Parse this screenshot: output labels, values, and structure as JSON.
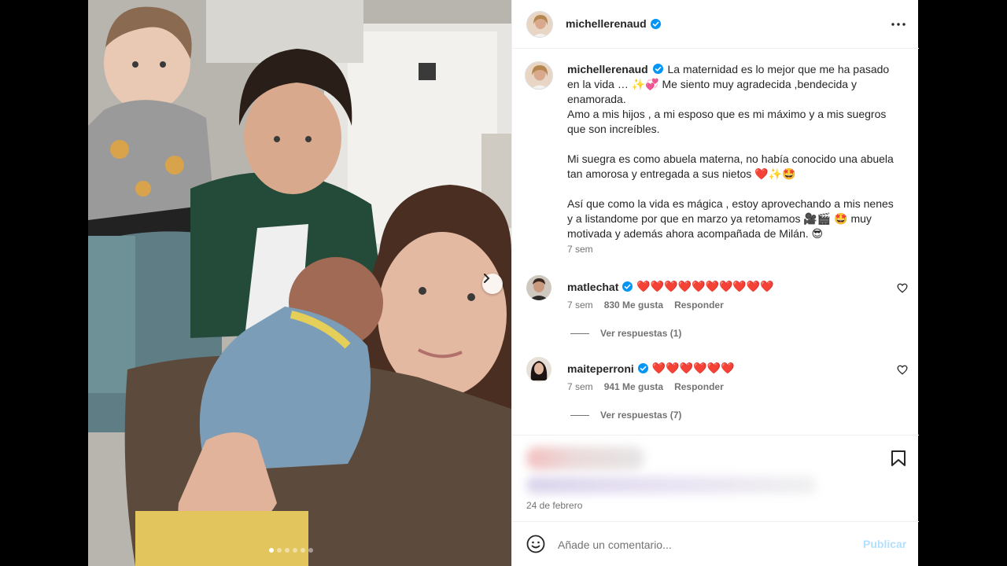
{
  "post": {
    "username": "michellerenaud",
    "verified": true,
    "caption": {
      "username": "michellerenaud",
      "lines": [
        "La maternidad es lo mejor que me ha pasado en la vida … ✨💞 Me siento muy agradecida ,bendecida y enamorada.",
        "Amo a mis hijos , a mi esposo que es mi máximo y a mis suegros que son increíbles.",
        "",
        "Mi suegra es como abuela materna, no había conocido una abuela tan amorosa y entregada a sus nietos ❤️✨🤩",
        "",
        "Así que como la vida es mágica , estoy aprovechando a mis nenes y a listandome por que en marzo ya retomamos 🎥🎬 🤩 muy motivada y además ahora acompañada de Milán. 😎"
      ],
      "time": "7 sem"
    },
    "date": "24 de febrero",
    "carousel": {
      "dot_count": 6,
      "active_index": 0
    }
  },
  "comments": [
    {
      "username": "matlechat",
      "verified": true,
      "text": "❤️❤️❤️❤️❤️❤️❤️❤️❤️❤️",
      "time": "7 sem",
      "likes": "830 Me gusta",
      "reply_label": "Responder",
      "view_replies": "Ver respuestas (1)"
    },
    {
      "username": "maiteperroni",
      "verified": true,
      "text": "❤️❤️❤️❤️❤️❤️",
      "time": "7 sem",
      "likes": "941 Me gusta",
      "reply_label": "Responder",
      "view_replies": "Ver respuestas (7)"
    }
  ],
  "comment_box": {
    "placeholder": "Añade un comentario...",
    "post_label": "Publicar"
  },
  "icons": {
    "more": "more-options-icon",
    "verified": "verified-badge-icon",
    "heart": "heart-icon",
    "bookmark": "bookmark-icon",
    "emoji": "emoji-icon",
    "next": "chevron-right-icon"
  },
  "colors": {
    "verified_blue": "#0095f6",
    "link_disabled": "#b2dffc",
    "muted_text": "#737373"
  }
}
